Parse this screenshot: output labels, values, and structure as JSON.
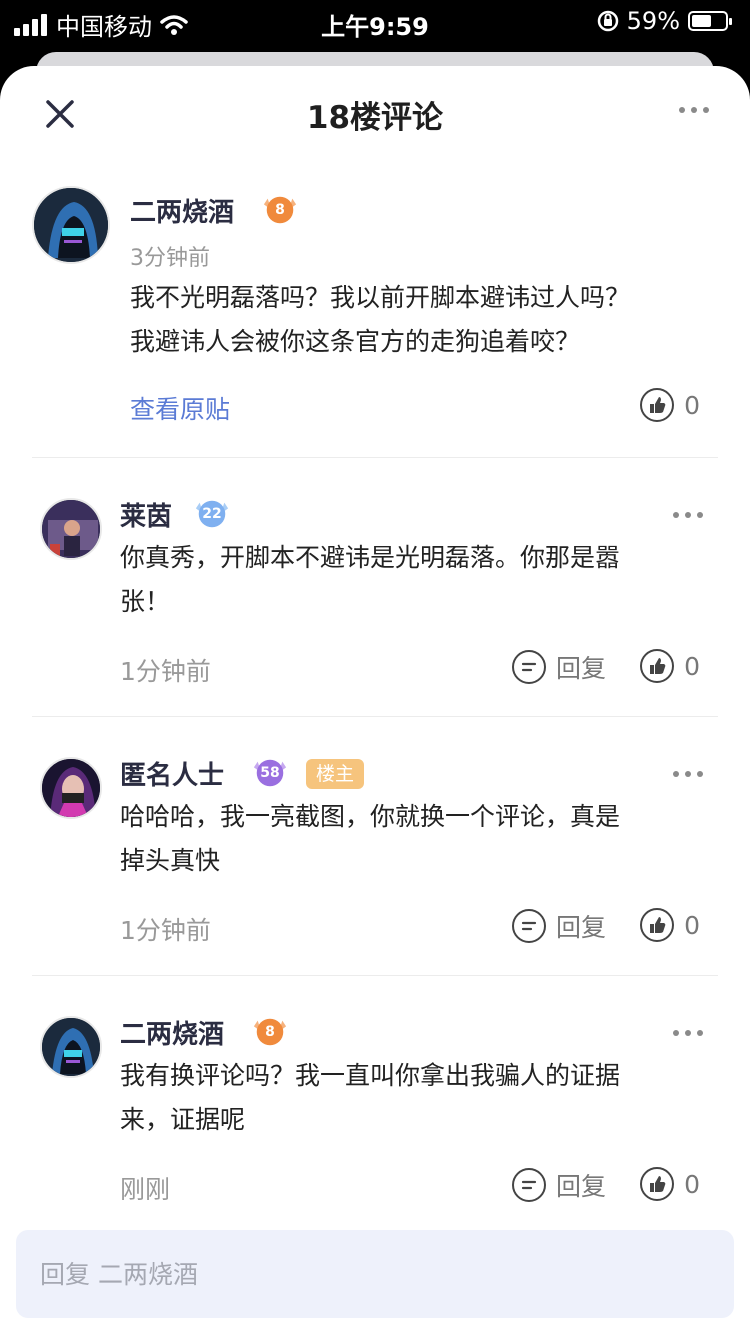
{
  "status_bar": {
    "carrier": "中国移动",
    "time": "上午9:59",
    "battery": "59%",
    "battery_level": 0.59
  },
  "header": {
    "title": "18楼评论"
  },
  "original_post": {
    "username": "二两烧酒",
    "level": "8",
    "time": "3分钟前",
    "text_line1": "我不光明磊落吗？我以前开脚本避讳过人吗？",
    "text_line2": "我避讳人会被你这条官方的走狗追着咬？",
    "view_original": "查看原贴",
    "like_count": "0"
  },
  "comments": [
    {
      "username": "莱茵",
      "level": "22",
      "text_line1": "你真秀，开脚本不避讳是光明磊落。你那是嚣",
      "text_line2": "张！",
      "time": "1分钟前",
      "reply_label": "回复",
      "like_count": "0"
    },
    {
      "username": "匿名人士",
      "level": "58",
      "tag": "楼主",
      "text_line1": "哈哈哈，我一亮截图，你就换一个评论，真是",
      "text_line2": "掉头真快",
      "time": "1分钟前",
      "reply_label": "回复",
      "like_count": "0"
    },
    {
      "username": "二两烧酒",
      "level": "8",
      "text_line1": "我有换评论吗？我一直叫你拿出我骗人的证据",
      "text_line2": "来，证据呢",
      "time": "刚刚",
      "reply_label": "回复",
      "like_count": "0"
    }
  ],
  "reply_input": {
    "placeholder": "回复 二两烧酒"
  },
  "colors": {
    "link": "#5b7bd5",
    "owner_tag": "#f6c47d",
    "orange_badge": "#f08a3c",
    "blue_badge": "#7fb0f0",
    "purple_badge": "#9a6fe0",
    "reply_bg": "#eef1fb"
  }
}
